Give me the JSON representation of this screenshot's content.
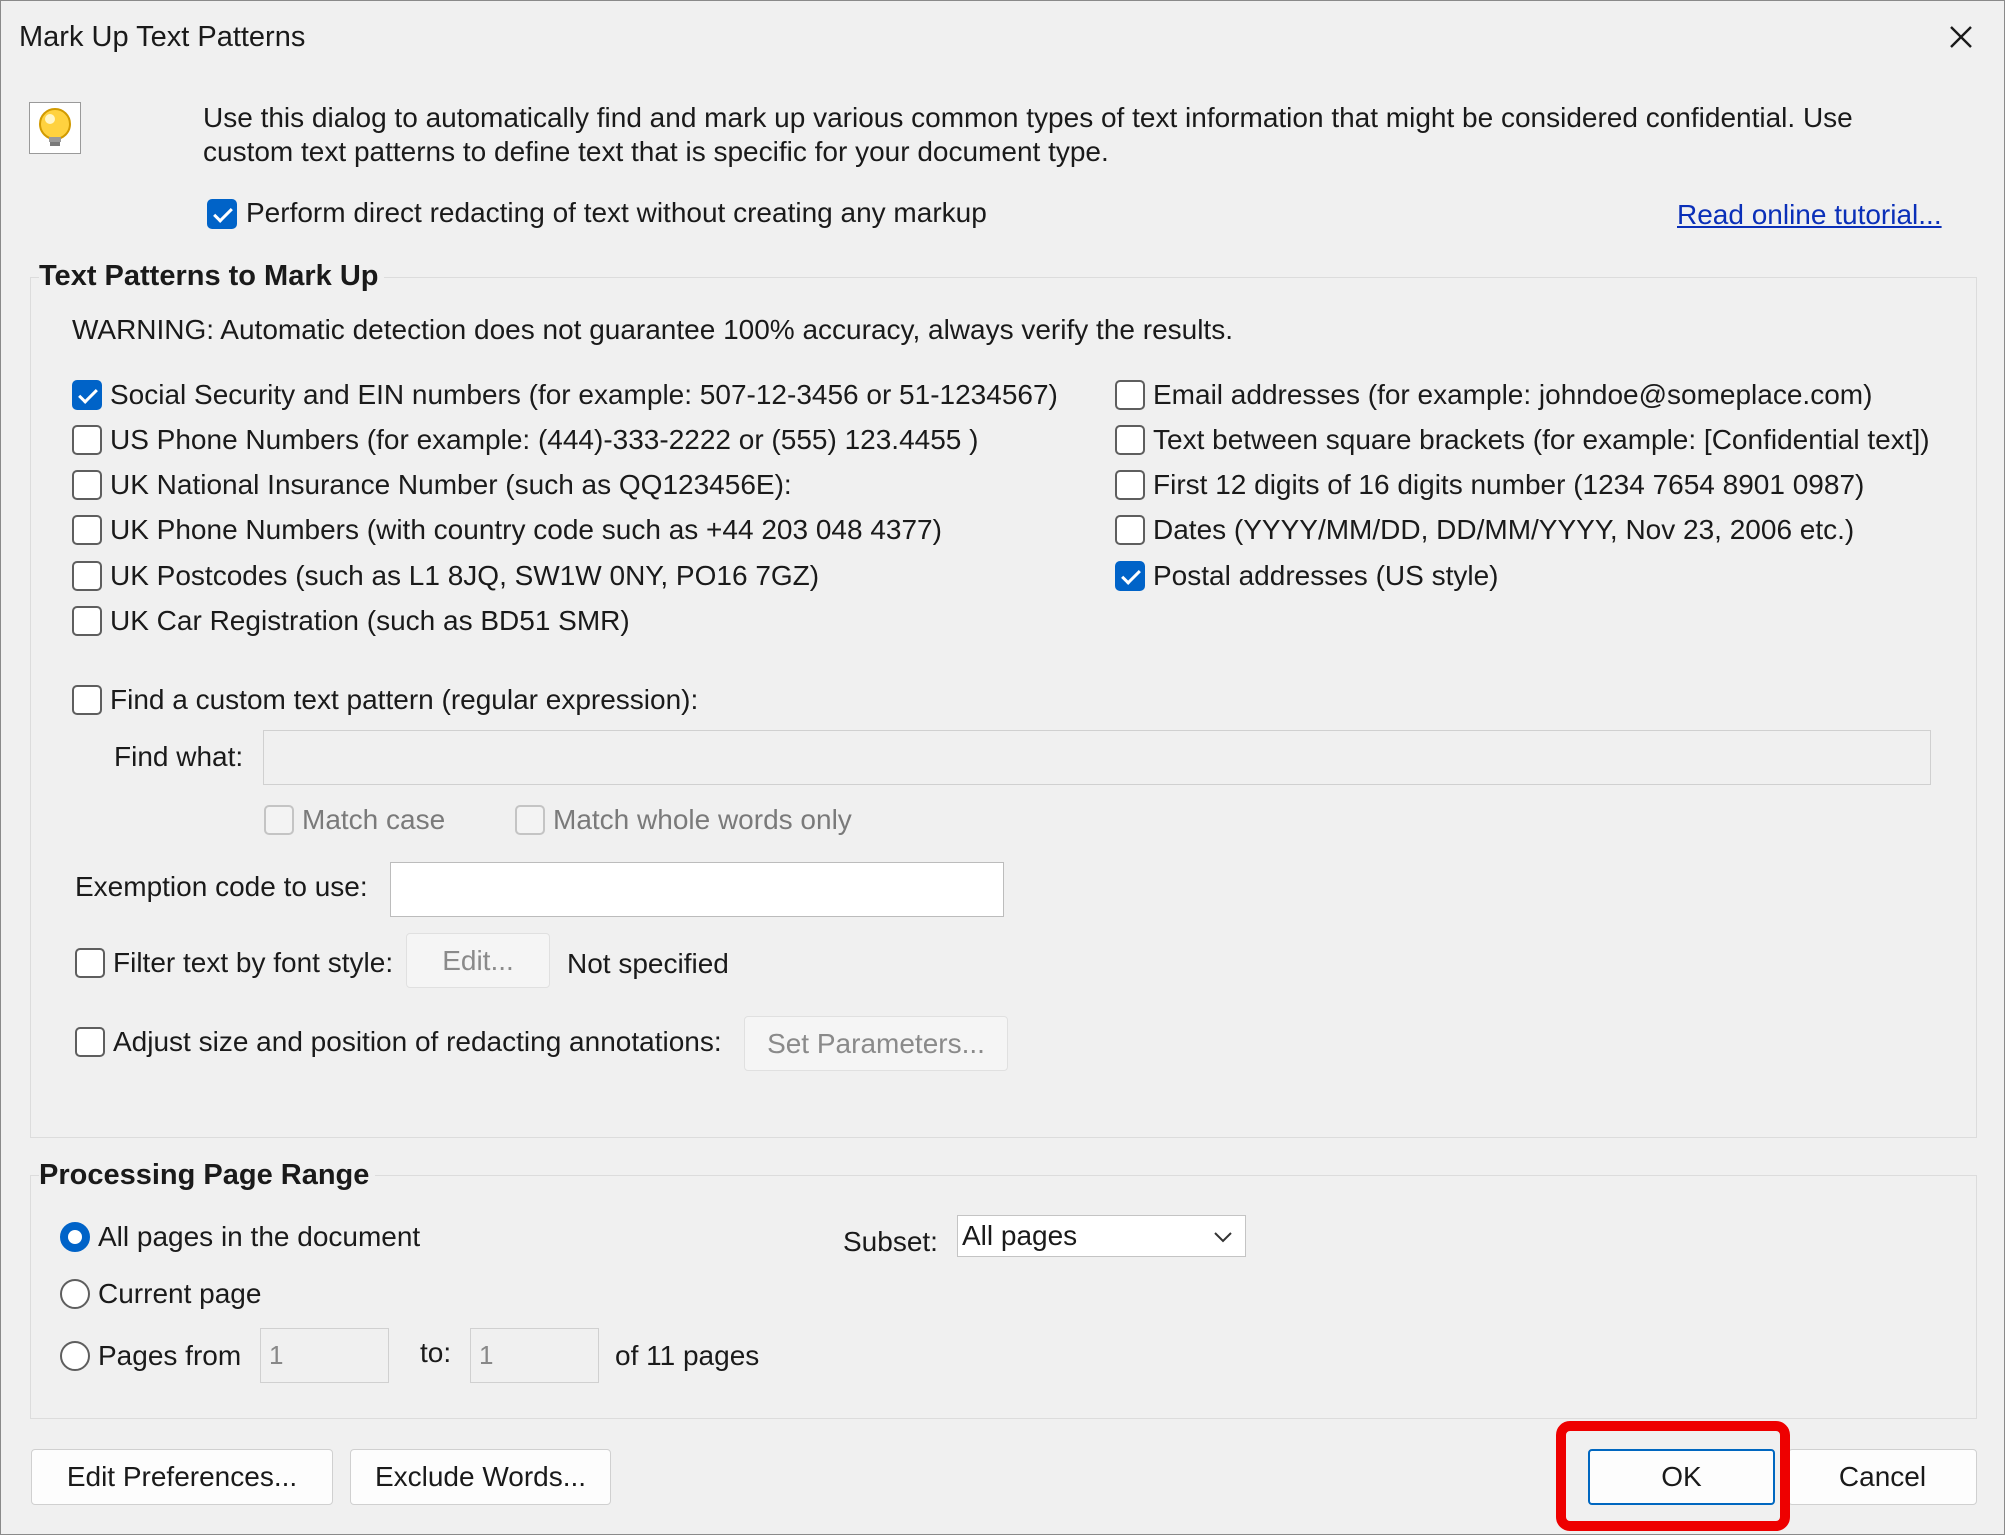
{
  "window": {
    "title": "Mark Up Text Patterns"
  },
  "intro": {
    "description": "Use this dialog to automatically find and mark up various common types of text information that might be considered confidential. Use custom text patterns to define text that is specific for your document type.",
    "direct_redact_label": "Perform direct redacting of text without creating any markup",
    "direct_redact_checked": true,
    "tutorial_link": "Read online tutorial..."
  },
  "patterns": {
    "heading": "Text Patterns to Mark Up",
    "warning": "WARNING: Automatic detection does not guarantee 100% accuracy, always verify the results.",
    "left": [
      {
        "label": "Social Security and EIN numbers (for example: 507-12-3456 or 51-1234567)",
        "checked": true
      },
      {
        "label": "US Phone Numbers (for example: (444)-333-2222 or (555) 123.4455 )",
        "checked": false
      },
      {
        "label": "UK National Insurance Number (such as QQ123456E):",
        "checked": false
      },
      {
        "label": "UK Phone Numbers (with country code such as +44 203 048 4377)",
        "checked": false
      },
      {
        "label": "UK Postcodes (such as L1 8JQ, SW1W 0NY, PO16 7GZ)",
        "checked": false
      },
      {
        "label": "UK Car Registration (such as BD51 SMR)",
        "checked": false
      }
    ],
    "right": [
      {
        "label": "Email addresses (for example: johndoe@someplace.com)",
        "checked": false
      },
      {
        "label": "Text between square brackets (for example: [Confidential text])",
        "checked": false
      },
      {
        "label": "First 12 digits of 16 digits number (1234 7654 8901 0987)",
        "checked": false
      },
      {
        "label": "Dates (YYYY/MM/DD, DD/MM/YYYY, Nov 23, 2006 etc.)",
        "checked": false
      },
      {
        "label": "Postal addresses (US style)",
        "checked": true
      }
    ],
    "custom_label": "Find a custom text pattern (regular expression):",
    "find_what_label": "Find what:",
    "find_what_value": "",
    "match_case_label": "Match case",
    "whole_words_label": "Match whole words only",
    "exemption_label": "Exemption code to use:",
    "exemption_value": "",
    "filter_font_label": "Filter text by font style:",
    "filter_edit_button": "Edit...",
    "filter_status": "Not specified",
    "adjust_label": "Adjust size and position of redacting annotations:",
    "set_params_button": "Set Parameters..."
  },
  "range": {
    "heading": "Processing Page Range",
    "all_pages_label": "All pages in the document",
    "current_page_label": "Current page",
    "pages_from_label": "Pages from",
    "from_value": "1",
    "to_label": "to:",
    "to_value": "1",
    "of_pages_label": "of 11 pages",
    "subset_label": "Subset:",
    "subset_value": "All pages",
    "selected": "all"
  },
  "buttons": {
    "edit_prefs": "Edit Preferences...",
    "exclude_words": "Exclude Words...",
    "ok": "OK",
    "cancel": "Cancel"
  },
  "colors": {
    "accent": "#0063c8",
    "highlight": "#ee0000",
    "link": "#0a2fb8"
  }
}
